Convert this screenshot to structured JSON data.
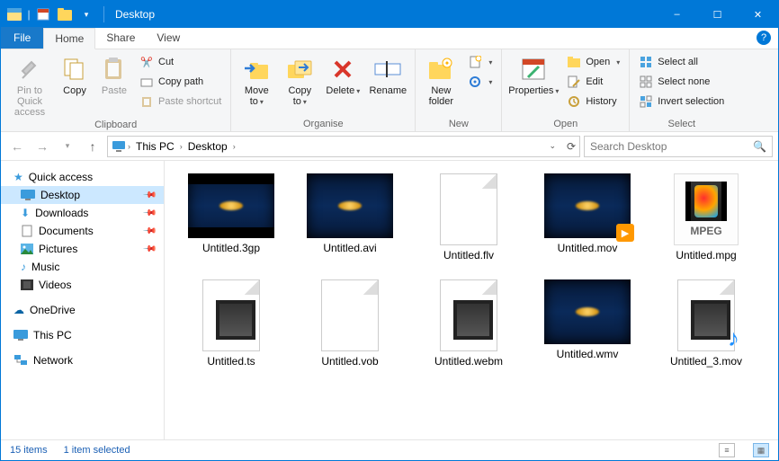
{
  "titlebar": {
    "title": "Desktop"
  },
  "window": {
    "minimize": "–",
    "maximize": "☐",
    "close": "✕"
  },
  "tabs": {
    "file": "File",
    "home": "Home",
    "share": "Share",
    "view": "View"
  },
  "ribbon": {
    "clipboard": {
      "label": "Clipboard",
      "pin": "Pin to Quick\naccess",
      "copy": "Copy",
      "paste": "Paste",
      "cut": "Cut",
      "copypath": "Copy path",
      "pasteshortcut": "Paste shortcut"
    },
    "organise": {
      "label": "Organise",
      "moveto": "Move\nto",
      "copyto": "Copy\nto",
      "delete": "Delete",
      "rename": "Rename"
    },
    "new": {
      "label": "New",
      "newfolder": "New\nfolder",
      "newitem": "",
      "easyaccess": ""
    },
    "open": {
      "label": "Open",
      "properties": "Properties",
      "open": "Open",
      "edit": "Edit",
      "history": "History"
    },
    "select": {
      "label": "Select",
      "selectall": "Select all",
      "selectnone": "Select none",
      "invert": "Invert selection"
    }
  },
  "breadcrumb": {
    "thispc": "This PC",
    "desktop": "Desktop"
  },
  "search": {
    "placeholder": "Search Desktop"
  },
  "sidebar": {
    "quickaccess": "Quick access",
    "desktop": "Desktop",
    "downloads": "Downloads",
    "documents": "Documents",
    "pictures": "Pictures",
    "music": "Music",
    "videos": "Videos",
    "onedrive": "OneDrive",
    "thispc": "This PC",
    "network": "Network"
  },
  "files": [
    {
      "name": "Untitled.3gp",
      "thumb": "video-bars"
    },
    {
      "name": "Untitled.avi",
      "thumb": "video"
    },
    {
      "name": "Untitled.flv",
      "thumb": "page"
    },
    {
      "name": "Untitled.mov",
      "thumb": "video-play"
    },
    {
      "name": "Untitled.mpg",
      "thumb": "mpeg"
    },
    {
      "name": "Untitled.ts",
      "thumb": "page-film"
    },
    {
      "name": "Untitled.vob",
      "thumb": "page"
    },
    {
      "name": "Untitled.webm",
      "thumb": "page-film"
    },
    {
      "name": "Untitled.wmv",
      "thumb": "video"
    },
    {
      "name": "Untitled_3.mov",
      "thumb": "page-film-music"
    }
  ],
  "status": {
    "items": "15 items",
    "selected": "1 item selected"
  },
  "mpeg_label": "MPEG"
}
